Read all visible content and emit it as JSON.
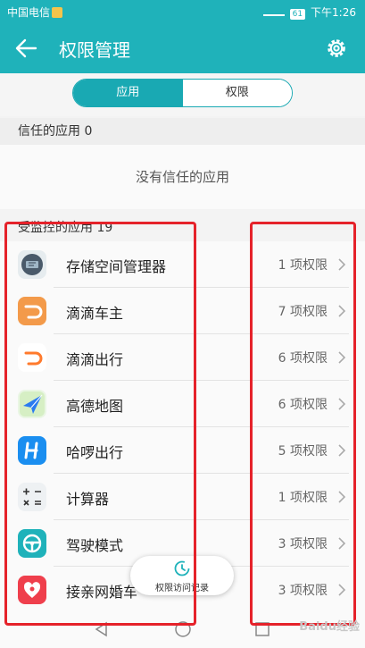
{
  "status_bar": {
    "carrier": "中国电信",
    "battery": "61",
    "time": "下午1:26"
  },
  "app_bar": {
    "title": "权限管理"
  },
  "tabs": [
    {
      "label": "应用",
      "active": true
    },
    {
      "label": "权限",
      "active": false
    }
  ],
  "trusted": {
    "header": "信任的应用 0",
    "empty_text": "没有信任的应用"
  },
  "monitored": {
    "header": "受监控的应用 19",
    "apps": [
      {
        "name": "存储空间管理器",
        "count": "1 项权限",
        "icon": "storage-manager-icon",
        "color": "#4a5a6a"
      },
      {
        "name": "滴滴车主",
        "count": "7 项权限",
        "icon": "didi-driver-icon",
        "color": "#f39a4a"
      },
      {
        "name": "滴滴出行",
        "count": "6 项权限",
        "icon": "didi-icon",
        "color": "#ff7a2c"
      },
      {
        "name": "高德地图",
        "count": "6 项权限",
        "icon": "amap-icon",
        "color": "#2a7bf0"
      },
      {
        "name": "哈啰出行",
        "count": "5 项权限",
        "icon": "hellobike-icon",
        "color": "#1a8ef0"
      },
      {
        "name": "计算器",
        "count": "1 项权限",
        "icon": "calculator-icon",
        "color": "#cfd6dc"
      },
      {
        "name": "驾驶模式",
        "count": "3 项权限",
        "icon": "driving-mode-icon",
        "color": "#1fb2ba"
      },
      {
        "name": "接亲网婚车",
        "count": "3 项权限",
        "icon": "wedding-car-icon",
        "color": "#ef3f4c"
      }
    ]
  },
  "fab": {
    "label": "权限访问记录"
  },
  "watermark": "Baidu经验",
  "colors": {
    "accent": "#1fb2ba",
    "highlight": "#e5222a"
  }
}
